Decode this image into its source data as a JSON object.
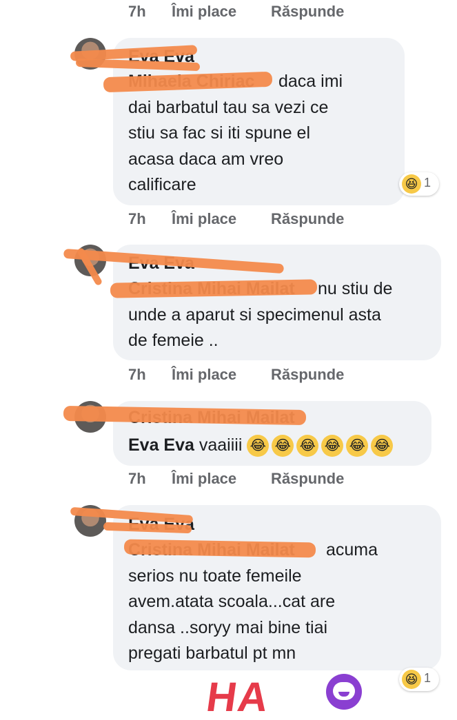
{
  "meta_labels": {
    "time": "7h",
    "like": "Îmi place",
    "reply": "Răspunde"
  },
  "comments": [
    {
      "author": "Eva Eva",
      "mention": "Mihaela Chiriac",
      "text": "daca imi\ndai barbatul tau sa vezi ce\nstiu sa fac si iti spune el\nacasa daca am vreo\ncalificare",
      "reaction_count": "1"
    },
    {
      "author": "Eva Eva",
      "mention": "Cristina Mihai Mailat",
      "text": "nu stiu de\nunde a aparut si specimenul asta\nde femeie .."
    },
    {
      "author": "Cristina Mihai Mailat",
      "mention": "Eva Eva",
      "text": "vaaiiii"
    },
    {
      "author": "Eva Eva",
      "mention": "Cristina Mihai Mailat",
      "text": "acuma\nserios nu toate  femeile\navem.atata scoala...cat are\ndansa ..soryy mai bine tiai\npregati barbatul pt mn",
      "reaction_count": "1"
    }
  ],
  "emoji": {
    "laugh": "😂",
    "squint": "😆"
  },
  "bottom": {
    "sticker_text": "HA"
  },
  "colors": {
    "bubble": "#f0f2f5",
    "scribble": "#f38a4c",
    "meta": "#65676b"
  }
}
